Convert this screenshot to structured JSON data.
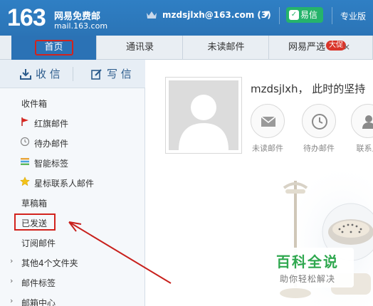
{
  "header": {
    "logo_number": "163",
    "logo_text": "网易免费邮",
    "logo_url": "mail.163.com",
    "account_email": "mzdsjlxh@163.com",
    "unread_count": "(3)",
    "yixin_label": "易信",
    "pro_label": "专业版"
  },
  "tabs": [
    {
      "label": "首页",
      "active": true
    },
    {
      "label": "通讯录"
    },
    {
      "label": "未读邮件"
    },
    {
      "label": "网易严选"
    }
  ],
  "tab_badge": "大促",
  "tab_close": "×",
  "sidebar": {
    "receive_label": "收 信",
    "write_label": "写 信",
    "folders": [
      {
        "label": "收件箱"
      },
      {
        "label": "红旗邮件",
        "icon": "red-flag-icon"
      },
      {
        "label": "待办邮件",
        "icon": "clock-icon"
      },
      {
        "label": "智能标签",
        "icon": "tag-stripes-icon"
      },
      {
        "label": "星标联系人邮件",
        "icon": "star-icon"
      },
      {
        "label": "草稿箱"
      },
      {
        "label": "已发送"
      },
      {
        "label": "订阅邮件"
      },
      {
        "label": "其他4个文件夹",
        "expandable": true
      },
      {
        "label": "邮件标签",
        "expandable": true
      },
      {
        "label": "邮箱中心",
        "expandable": true
      }
    ]
  },
  "main": {
    "greeting": "mzdsjlxh， 此时的坚持",
    "quick_items": [
      {
        "label": "未读邮件",
        "icon": "envelope-icon"
      },
      {
        "label": "待办邮件",
        "icon": "clock-icon"
      },
      {
        "label": "联系人",
        "icon": "contacts-icon"
      }
    ]
  },
  "watermark": {
    "title": "百科全说",
    "subtitle": "助你轻松解决"
  },
  "colors": {
    "header_blue": "#2b74b6",
    "annotation_red": "#d2231d",
    "watermark_green": "#2fa84f"
  }
}
